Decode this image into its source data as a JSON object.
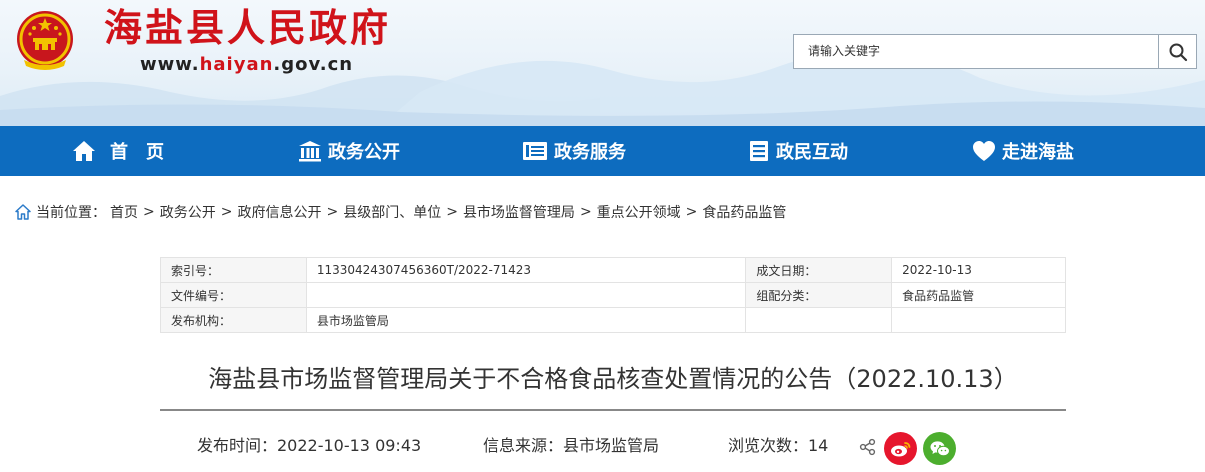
{
  "header": {
    "site_title": "海盐县人民政府",
    "site_url_prefix": "www.",
    "site_url_domain": "haiyan",
    "site_url_suffix": ".gov.cn",
    "brand_color": "#d0131a"
  },
  "search": {
    "placeholder": "请输入关键字",
    "button_icon": "search-icon"
  },
  "nav": {
    "color": "#0d6cbf",
    "items": [
      {
        "label": "首　页",
        "icon": "home-icon"
      },
      {
        "label": "政务公开",
        "icon": "building-icon"
      },
      {
        "label": "政务服务",
        "icon": "book-icon"
      },
      {
        "label": "政民互动",
        "icon": "list-icon"
      },
      {
        "label": "走进海盐",
        "icon": "heart-icon"
      }
    ]
  },
  "breadcrumb": {
    "label": "当前位置：",
    "items": [
      "首页",
      "政务公开",
      "政府信息公开",
      "县级部门、单位",
      "县市场监督管理局",
      "重点公开领域",
      "食品药品监管"
    ],
    "separator": ">"
  },
  "meta": {
    "index_label": "索引号：",
    "index_value": "11330424307456360T/2022-71423",
    "date_label": "成文日期：",
    "date_value": "2022-10-13",
    "docno_label": "文件编号：",
    "docno_value": "",
    "category_label": "组配分类：",
    "category_value": "食品药品监管",
    "publisher_label": "发布机构：",
    "publisher_value": "县市场监管局",
    "blank_value": ""
  },
  "article": {
    "title": "海盐县市场监督管理局关于不合格食品核查处置情况的公告（2022.10.13）",
    "publish_time": "发布时间：2022-10-13 09:43",
    "source": "信息来源：县市场监管局",
    "views": "浏览次数：14"
  },
  "share": {
    "icons": [
      "share-icon",
      "weibo-icon",
      "wechat-icon"
    ]
  }
}
